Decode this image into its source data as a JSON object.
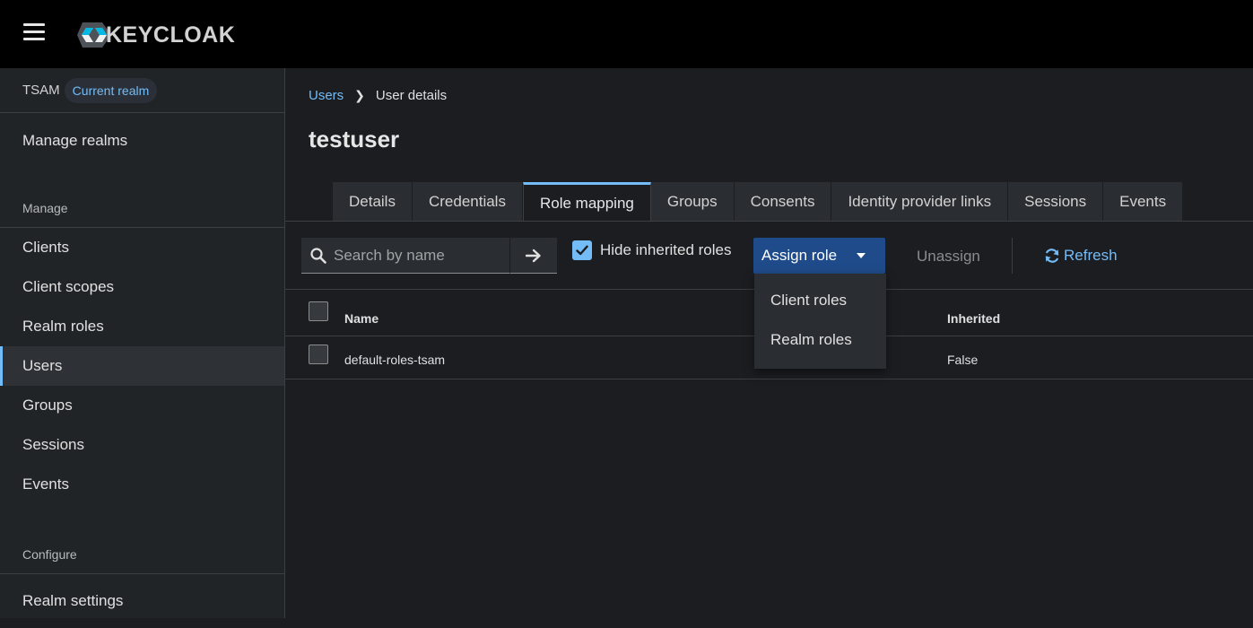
{
  "header": {
    "brand": "KEYCLOAK"
  },
  "sidebar": {
    "realm_name": "TSAM",
    "realm_badge": "Current realm",
    "manage_realms": "Manage realms",
    "section_manage": "Manage",
    "items": [
      {
        "label": "Clients"
      },
      {
        "label": "Client scopes"
      },
      {
        "label": "Realm roles"
      },
      {
        "label": "Users"
      },
      {
        "label": "Groups"
      },
      {
        "label": "Sessions"
      },
      {
        "label": "Events"
      }
    ],
    "section_configure": "Configure",
    "realm_settings": "Realm settings"
  },
  "breadcrumb": {
    "parent": "Users",
    "current": "User details"
  },
  "page_title": "testuser",
  "tabs": [
    {
      "label": "Details"
    },
    {
      "label": "Credentials"
    },
    {
      "label": "Role mapping"
    },
    {
      "label": "Groups"
    },
    {
      "label": "Consents"
    },
    {
      "label": "Identity provider links"
    },
    {
      "label": "Sessions"
    },
    {
      "label": "Events"
    }
  ],
  "toolbar": {
    "search_placeholder": "Search by name",
    "hide_inherited_label": "Hide inherited roles",
    "assign_role_label": "Assign role",
    "unassign_label": "Unassign",
    "refresh_label": "Refresh"
  },
  "dropdown": {
    "items": [
      {
        "label": "Client roles"
      },
      {
        "label": "Realm roles"
      }
    ]
  },
  "table": {
    "columns": {
      "name": "Name",
      "inherited": "Inherited"
    },
    "rows": [
      {
        "name": "default-roles-tsam",
        "inherited": "False"
      }
    ]
  },
  "colors": {
    "accent": "#73bcf7",
    "primary_button": "#1f4b8a",
    "masthead": "#000000"
  }
}
